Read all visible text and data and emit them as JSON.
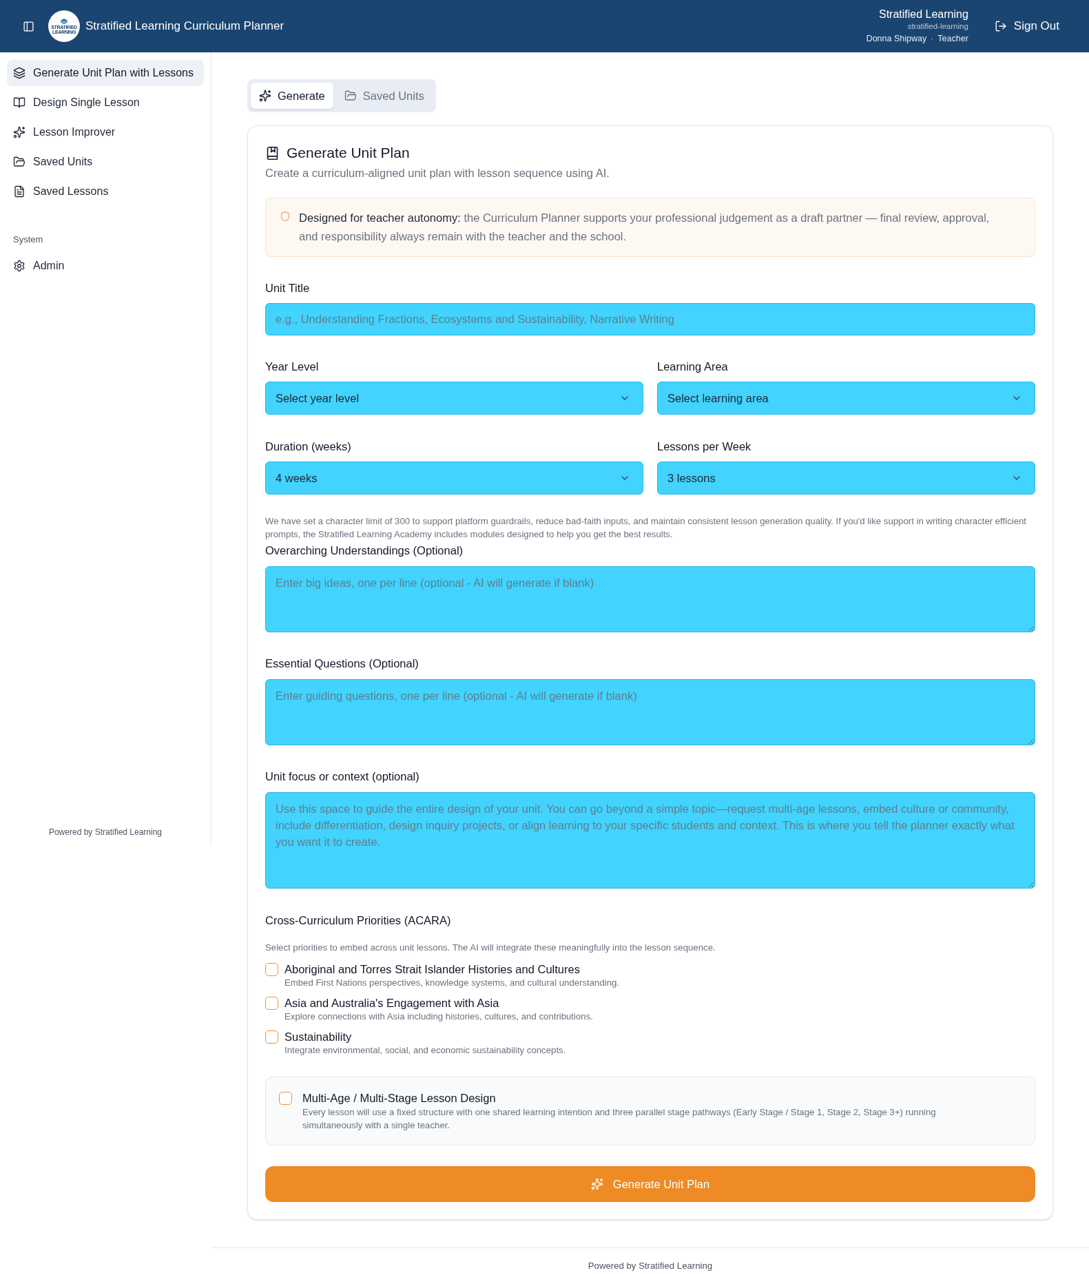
{
  "header": {
    "app_title": "Stratified Learning Curriculum Planner",
    "logo_text": [
      "STRATIFIED",
      "LEARNING"
    ],
    "org_name": "Stratified Learning",
    "org_slug": "stratified-learning",
    "user_name": "Donna Shipway",
    "separator": "·",
    "role": "Teacher",
    "sign_out": "Sign Out"
  },
  "sidebar": {
    "items": [
      {
        "label": "Generate Unit Plan with Lessons",
        "selected": true
      },
      {
        "label": "Design Single Lesson",
        "selected": false
      },
      {
        "label": "Lesson Improver",
        "selected": false
      },
      {
        "label": "Saved Units",
        "selected": false
      },
      {
        "label": "Saved Lessons",
        "selected": false
      }
    ],
    "section": {
      "heading": "System",
      "items": [
        {
          "label": "Admin",
          "selected": false
        }
      ]
    },
    "footer": "Powered by Stratified Learning"
  },
  "tabs": [
    {
      "label": "Generate",
      "selected": true
    },
    {
      "label": "Saved Units",
      "selected": false
    }
  ],
  "card": {
    "title": "Generate Unit Plan",
    "subtitle": "Create a curriculum-aligned unit plan with lesson sequence using AI.",
    "notice": {
      "lead": "Designed for teacher autonomy:",
      "text": "the Curriculum Planner supports your professional judgement as a draft partner — final review, approval, and responsibility always remain with the teacher and the school."
    },
    "unit_title": {
      "label": "Unit Title",
      "placeholder": "e.g., Understanding Fractions, Ecosystems and Sustainability, Narrative Writing"
    },
    "selects": [
      {
        "label": "Year Level",
        "value": "Select year level"
      },
      {
        "label": "Learning Area",
        "value": "Select learning area"
      },
      {
        "label": "Duration (weeks)",
        "value": "4 weeks"
      },
      {
        "label": "Lessons per Week",
        "value": "3 lessons"
      }
    ],
    "char_limit_note": "We have set a character limit of 300 to support platform guardrails, reduce bad-faith inputs, and maintain consistent lesson generation quality. If you'd like support in writing character efficient prompts, the Stratified Learning Academy includes modules designed to help you get the best results.",
    "textareas": [
      {
        "label": "Overarching Understandings (Optional)",
        "placeholder": "Enter big ideas, one per line (optional - AI will generate if blank)"
      },
      {
        "label": "Essential Questions (Optional)",
        "placeholder": "Enter guiding questions, one per line (optional - AI will generate if blank)"
      },
      {
        "label": "Unit focus or context (optional)",
        "placeholder": "Use this space to guide the entire design of your unit. You can go beyond a simple topic—request multi-age lessons, embed culture or community, include differentiation, design inquiry projects, or align learning to your specific students and context. This is where you tell the planner exactly what you want it to create."
      }
    ],
    "priorities": {
      "heading": "Cross-Curriculum Priorities (ACARA)",
      "description": "Select priorities to embed across unit lessons. The AI will integrate these meaningfully into the lesson sequence.",
      "items": [
        {
          "label": "Aboriginal and Torres Strait Islander Histories and Cultures",
          "description": "Embed First Nations perspectives, knowledge systems, and cultural understanding.",
          "checked": false
        },
        {
          "label": "Asia and Australia's Engagement with Asia",
          "description": "Explore connections with Asia including histories, cultures, and contributions.",
          "checked": false
        },
        {
          "label": "Sustainability",
          "description": "Integrate environmental, social, and economic sustainability concepts.",
          "checked": false
        }
      ]
    },
    "multi_age": {
      "label": "Multi-Age / Multi-Stage Lesson Design",
      "description": "Every lesson will use a fixed structure with one shared learning intention and three parallel stage pathways (Early Stage / Stage 1, Stage 2, Stage 3+) running simultaneously with a single teacher.",
      "checked": false
    },
    "generate_button": "Generate Unit Plan"
  },
  "footer": "Powered by Stratified Learning"
}
